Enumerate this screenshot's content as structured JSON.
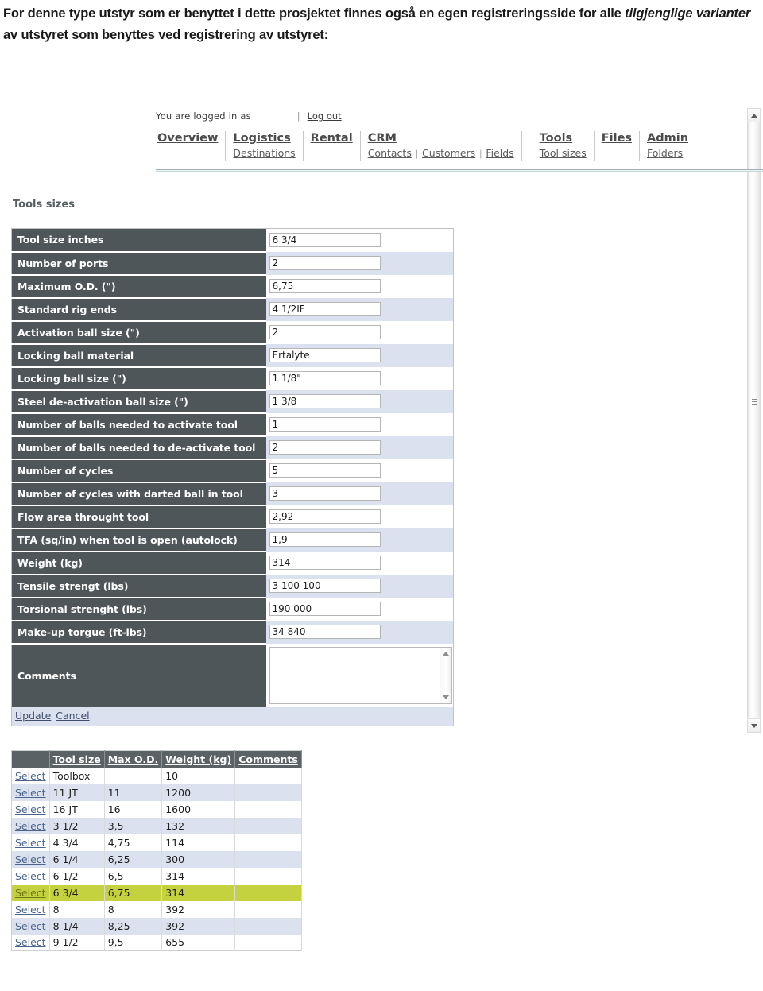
{
  "intro": {
    "line1_a": "For denne type utstyr som er benyttet i dette prosjektet finnes også en egen registreringsside for alle ",
    "line1_b": "tilgjenglige varianter",
    "line1_c": " av utstyret som benyttes ved registrering av utstyret:"
  },
  "app": {
    "login": {
      "label": "You are logged in as",
      "username": "",
      "divider": "|",
      "logout": "Log out"
    },
    "nav": [
      {
        "main": "Overview",
        "subs": []
      },
      {
        "main": "Logistics",
        "subs": [
          "Destinations"
        ]
      },
      {
        "main": "Rental",
        "subs": []
      },
      {
        "main": "CRM",
        "subs": [
          "Contacts",
          "Customers",
          "Fields"
        ]
      },
      {
        "main": "Tools",
        "subs": [
          "Tool sizes"
        ]
      },
      {
        "main": "Files",
        "subs": []
      },
      {
        "main": "Admin",
        "subs": [
          "Folders"
        ]
      }
    ]
  },
  "page": {
    "caption": "Tools sizes"
  },
  "form": {
    "rows": [
      {
        "label": "Tool size inches",
        "value": "6 3/4"
      },
      {
        "label": "Number of ports",
        "value": "2"
      },
      {
        "label": "Maximum O.D. (\")",
        "value": "6,75"
      },
      {
        "label": "Standard rig ends",
        "value": "4 1/2IF"
      },
      {
        "label": "Activation ball size (\")",
        "value": "2"
      },
      {
        "label": "Locking ball material",
        "value": "Ertalyte"
      },
      {
        "label": "Locking ball size (\")",
        "value": "1 1/8\""
      },
      {
        "label": "Steel de-activation ball size (\")",
        "value": "1 3/8"
      },
      {
        "label": "Number of balls needed to activate tool",
        "value": "1"
      },
      {
        "label": "Number of balls needed to de-activate tool",
        "value": "2"
      },
      {
        "label": "Number of cycles",
        "value": "5"
      },
      {
        "label": "Number of cycles with darted ball in tool",
        "value": "3"
      },
      {
        "label": "Flow area throught tool",
        "value": "2,92"
      },
      {
        "label": "TFA (sq/in) when tool is open (autolock)",
        "value": "1,9"
      },
      {
        "label": "Weight (kg)",
        "value": "314"
      },
      {
        "label": "Tensile strengt (lbs)",
        "value": "3 100 100"
      },
      {
        "label": "Torsional strenght (lbs)",
        "value": "190 000"
      },
      {
        "label": "Make-up torgue (ft-lbs)",
        "value": "34 840"
      }
    ],
    "comments": {
      "label": "Comments",
      "value": ""
    },
    "actions": {
      "update": "Update",
      "cancel": "Cancel"
    }
  },
  "grid": {
    "headers": [
      "",
      "Tool size",
      "Max O.D.",
      "Weight (kg)",
      "Comments"
    ],
    "select_label": "Select",
    "rows": [
      {
        "tool_size": "Toolbox",
        "max_od": "",
        "weight": "10",
        "comments": ""
      },
      {
        "tool_size": "11 JT",
        "max_od": "11",
        "weight": "1200",
        "comments": ""
      },
      {
        "tool_size": "16 JT",
        "max_od": "16",
        "weight": "1600",
        "comments": ""
      },
      {
        "tool_size": "3 1/2",
        "max_od": "3,5",
        "weight": "132",
        "comments": ""
      },
      {
        "tool_size": "4 3/4",
        "max_od": "4,75",
        "weight": "114",
        "comments": ""
      },
      {
        "tool_size": "6 1/4",
        "max_od": "6,25",
        "weight": "300",
        "comments": ""
      },
      {
        "tool_size": "6 1/2",
        "max_od": "6,5",
        "weight": "314",
        "comments": ""
      },
      {
        "tool_size": "6 3/4",
        "max_od": "6,75",
        "weight": "314",
        "comments": ""
      },
      {
        "tool_size": "8",
        "max_od": "8",
        "weight": "392",
        "comments": ""
      },
      {
        "tool_size": "8 1/4",
        "max_od": "8,25",
        "weight": "392",
        "comments": ""
      },
      {
        "tool_size": "9 1/2",
        "max_od": "9,5",
        "weight": "655",
        "comments": ""
      }
    ],
    "selected_row_index": 7
  },
  "colors": {
    "label_bg": "#4e5659",
    "alt_row": "#dbe1ee",
    "highlight_row": "#c3d23e",
    "grid_header_bg": "#5a6265",
    "link": "#4a648c"
  }
}
